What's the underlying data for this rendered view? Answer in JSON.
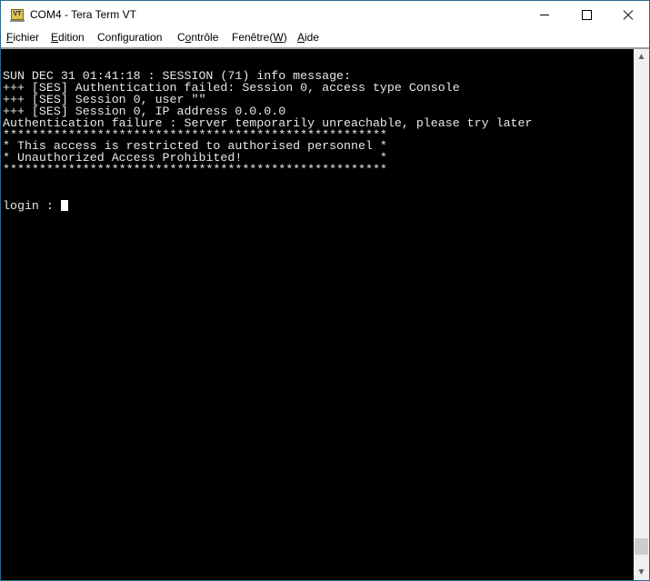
{
  "window": {
    "title": "COM4 - Tera Term VT",
    "app_icon_label": "VT",
    "controls": {
      "minimize": "minimize",
      "maximize": "maximize",
      "close": "close"
    }
  },
  "menu": [
    {
      "pre": "",
      "accel": "F",
      "post": "ichier"
    },
    {
      "pre": "",
      "accel": "E",
      "post": "dition"
    },
    {
      "pre": "Confi",
      "accel": "g",
      "post": "uration"
    },
    {
      "pre": "C",
      "accel": "o",
      "post": "ntrôle"
    },
    {
      "pre": "Fenêtre(",
      "accel": "W",
      "post": ")"
    },
    {
      "pre": "",
      "accel": "A",
      "post": "ide"
    }
  ],
  "terminal": {
    "lines": [
      "SUN DEC 31 01:41:18 : SESSION (71) info message:",
      "+++ [SES] Authentication failed: Session 0, access type Console",
      "+++ [SES] Session 0, user \"\"",
      "+++ [SES] Session 0, IP address 0.0.0.0",
      "Authentication failure : Server temporarily unreachable, please try later",
      "*****************************************************",
      "* This access is restricted to authorised personnel *",
      "* Unauthorized Access Prohibited!                   *",
      "*****************************************************",
      "",
      "",
      "login : "
    ]
  },
  "scrollbar": {
    "position_fraction": 0.98
  }
}
